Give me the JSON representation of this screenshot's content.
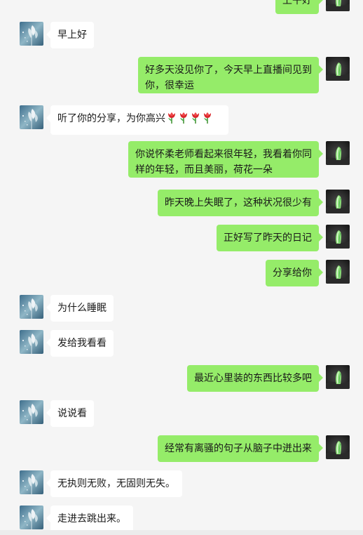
{
  "chat": {
    "messages": [
      {
        "side": "right",
        "text": "上午好"
      },
      {
        "side": "left",
        "text": "早上好"
      },
      {
        "side": "right",
        "text": "好多天没见你了，今天早上直播间见到你，很幸运"
      },
      {
        "side": "left",
        "text": "听了你的分享，为你高兴",
        "emoji_name": "tulip-emoji",
        "emoji_count": 4
      },
      {
        "side": "right",
        "text": "你说怀柔老师看起来很年轻，我看着你同样的年轻，而且美丽，荷花一朵"
      },
      {
        "side": "right",
        "text": "昨天晚上失眠了，这种状况很少有"
      },
      {
        "side": "right",
        "text": "正好写了昨天的日记"
      },
      {
        "side": "right",
        "text": "分享给你"
      },
      {
        "side": "left",
        "text": "为什么睡眠"
      },
      {
        "side": "left",
        "text": "发给我看看"
      },
      {
        "side": "right",
        "text": "最近心里装的东西比较多吧"
      },
      {
        "side": "left",
        "text": "说说看"
      },
      {
        "side": "right",
        "text": "经常有离骚的句子从脑子中迸出来"
      },
      {
        "side": "left",
        "text": "无执则无败，无固则无失。"
      },
      {
        "side": "left",
        "text": "走进去跳出来。"
      }
    ]
  },
  "colors": {
    "background": "#f5f5f5",
    "own_bubble": "#95ec69",
    "other_bubble": "#ffffff",
    "text": "#191919"
  }
}
